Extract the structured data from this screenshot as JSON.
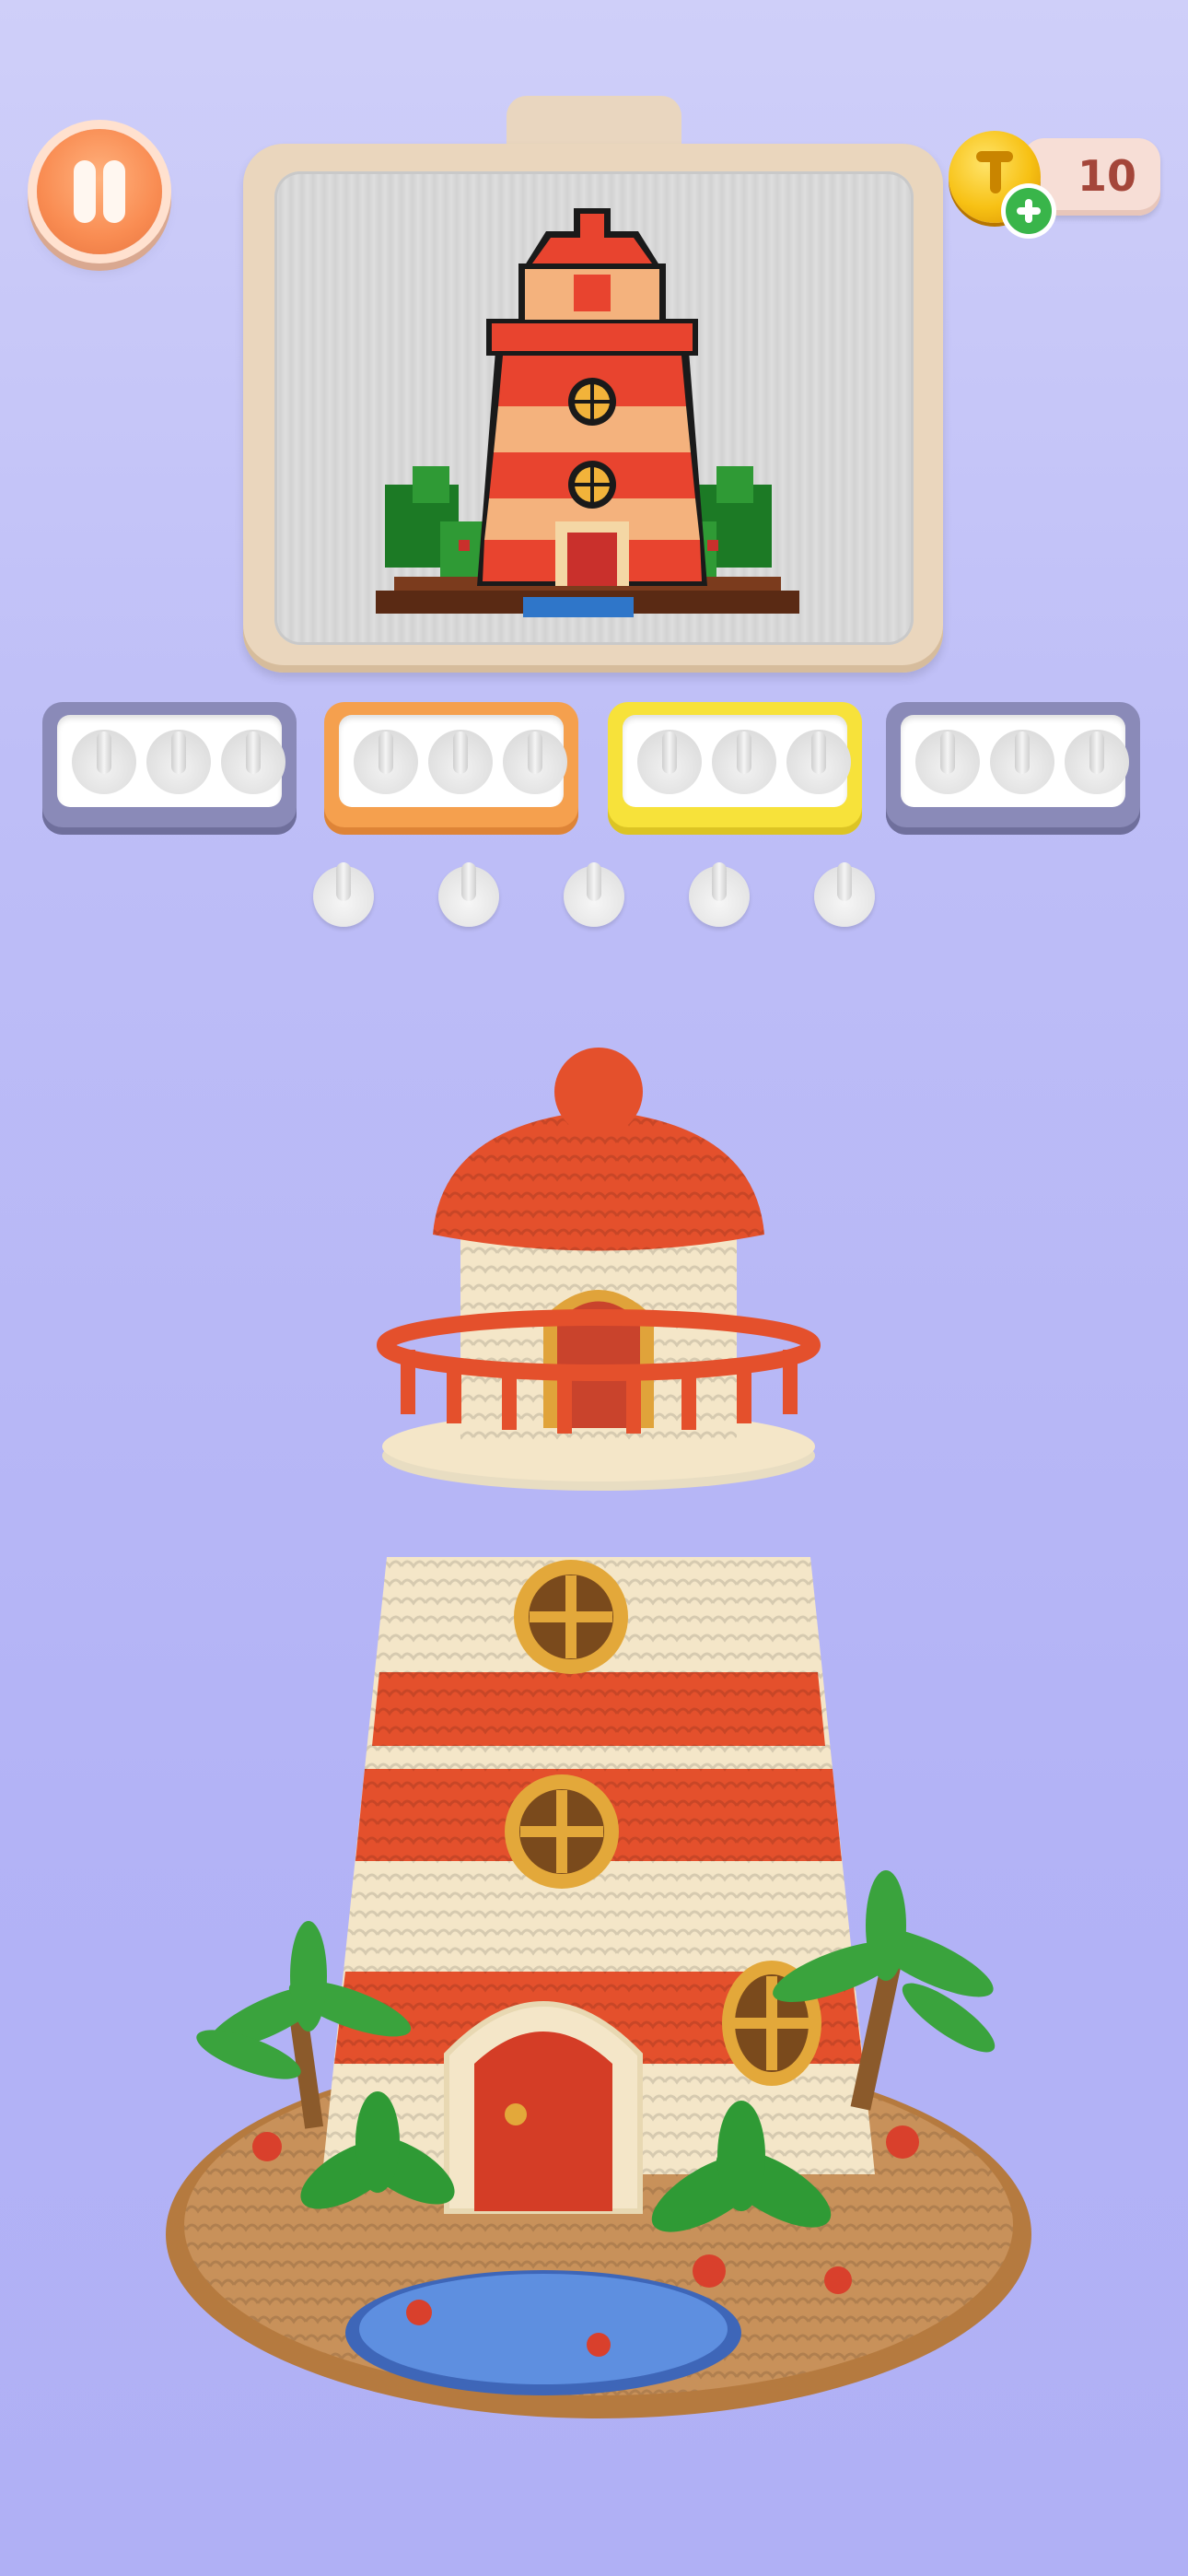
{
  "hud": {
    "coins": "10",
    "pause_icon": "pause-icon",
    "coin_icon": "coin-icon",
    "add_icon": "plus-icon"
  },
  "preview": {
    "subject": "lighthouse-pixel-pattern"
  },
  "trays": [
    {
      "color": "#8a8ab8",
      "pegs": 3
    },
    {
      "color": "#f5a04e",
      "pegs": 3
    },
    {
      "color": "#f7e23a",
      "pegs": 3
    },
    {
      "color": "#8a8ab8",
      "pegs": 3
    }
  ],
  "free_pegs": 5,
  "model": {
    "subject": "knitted-lighthouse"
  },
  "colors": {
    "red": "#e4502c",
    "cream": "#f4e6c8",
    "gold": "#e3a83a",
    "green": "#3aa33d",
    "sand": "#c8915a",
    "water": "#5e8fe0"
  }
}
